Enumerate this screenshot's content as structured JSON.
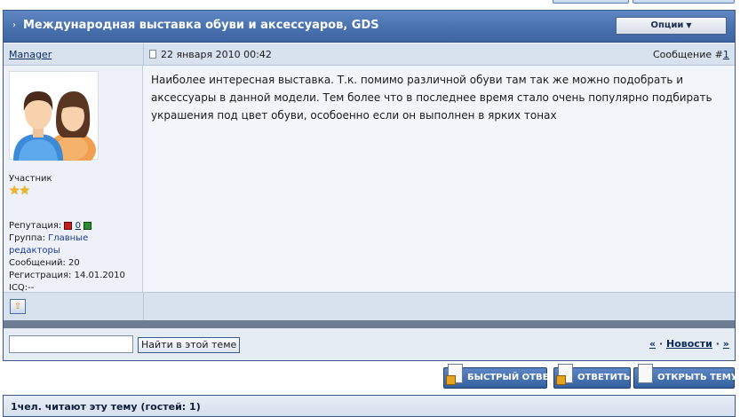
{
  "topic": {
    "title": "Международная выставка обуви и аксессуаров, GDS",
    "options_label": "Опции"
  },
  "post": {
    "author": "Manager",
    "date": "22 января 2010 00:42",
    "number_label": "Сообщение #",
    "number": "1",
    "message": "Наиболее интересная выставка. Т.к. помимо различной обуви там так же можно подобрать и аксессуары в данной модели. Тем более что в последнее время стало очень популярно подбирать украшения под цвет обуви, особоенно если он выполнен в ярких тонах"
  },
  "profile": {
    "user_title": "Участник",
    "star_count": 2,
    "stars": "★★",
    "reputation_label": "Репутация:",
    "reputation_value": "0",
    "group_label": "Группа:",
    "group_value_line1": "Главные",
    "group_value_line2": "редакторы",
    "posts": "Сообщений: 20",
    "registration": "Регистрация: 14.01.2010",
    "icq": "ICQ:--"
  },
  "search": {
    "input_value": "",
    "button_label": "Найти в этой теме"
  },
  "navigation": {
    "prev": "«",
    "news": "Новости",
    "dot": "·",
    "next": "»"
  },
  "actions": {
    "quick_reply": "Быстрый ответ",
    "reply": "Ответить",
    "new_topic": "Открыть тему"
  },
  "readers": {
    "text": "1чел. читают эту тему (гостей: 1)"
  },
  "colors": {
    "title_bar": "#4a73b0",
    "button_blue": "#34609f",
    "star": "#f2b51c"
  }
}
